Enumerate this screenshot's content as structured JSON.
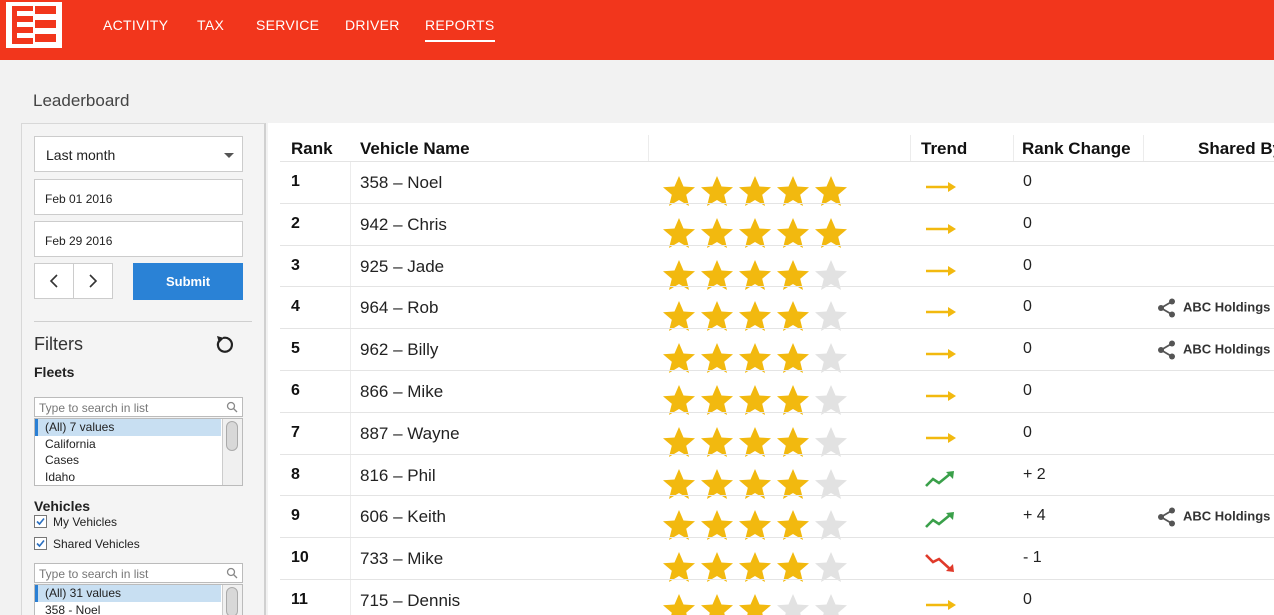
{
  "nav": {
    "items": [
      {
        "label": "ACTIVITY",
        "active": false
      },
      {
        "label": "TAX",
        "active": false
      },
      {
        "label": "SERVICE",
        "active": false
      },
      {
        "label": "DRIVER",
        "active": false
      },
      {
        "label": "REPORTS",
        "active": true
      }
    ]
  },
  "page_title": "Leaderboard",
  "sidebar": {
    "period": "Last month",
    "start_date": "Feb 01 2016",
    "end_date": "Feb 29 2016",
    "submit_label": "Submit",
    "filters_title": "Filters",
    "fleets_label": "Fleets",
    "fleets_search_placeholder": "Type to search in list",
    "fleets": [
      "(All) 7 values",
      "California",
      "Cases",
      "Idaho"
    ],
    "vehicles_label": "Vehicles",
    "my_vehicles_label": "My Vehicles",
    "my_vehicles_checked": true,
    "shared_vehicles_label": "Shared Vehicles",
    "shared_vehicles_checked": true,
    "vehicles_search_placeholder": "Type to search in list",
    "vehicles": [
      "(All) 31 values",
      "358 - Noel"
    ]
  },
  "table": {
    "headers": {
      "rank": "Rank",
      "vehicle": "Vehicle Name",
      "trend": "Trend",
      "rank_change": "Rank Change",
      "shared_by": "Shared By"
    },
    "rows": [
      {
        "rank": "1",
        "name": "358 – Noel",
        "stars": 5,
        "trend": "flat",
        "change": "0",
        "shared_by": ""
      },
      {
        "rank": "2",
        "name": "942 – Chris",
        "stars": 5,
        "trend": "flat",
        "change": "0",
        "shared_by": ""
      },
      {
        "rank": "3",
        "name": "925 – Jade",
        "stars": 4,
        "trend": "flat",
        "change": "0",
        "shared_by": ""
      },
      {
        "rank": "4",
        "name": "964 – Rob",
        "stars": 4,
        "trend": "flat",
        "change": "0",
        "shared_by": "ABC Holdings"
      },
      {
        "rank": "5",
        "name": "962 – Billy",
        "stars": 4,
        "trend": "flat",
        "change": "0",
        "shared_by": "ABC Holdings"
      },
      {
        "rank": "6",
        "name": "866 – Mike",
        "stars": 4,
        "trend": "flat",
        "change": "0",
        "shared_by": ""
      },
      {
        "rank": "7",
        "name": "887 – Wayne",
        "stars": 4,
        "trend": "flat",
        "change": "0",
        "shared_by": ""
      },
      {
        "rank": "8",
        "name": "816 – Phil",
        "stars": 4,
        "trend": "up",
        "change": "+ 2",
        "shared_by": ""
      },
      {
        "rank": "9",
        "name": "606 – Keith",
        "stars": 4,
        "trend": "up",
        "change": "+ 4",
        "shared_by": "ABC Holdings"
      },
      {
        "rank": "10",
        "name": "733 – Mike",
        "stars": 4,
        "trend": "down",
        "change": "- 1",
        "shared_by": ""
      },
      {
        "rank": "11",
        "name": "715 – Dennis",
        "stars": 3,
        "trend": "flat",
        "change": "0",
        "shared_by": ""
      }
    ]
  },
  "colors": {
    "brand": "#f2361c",
    "submit": "#2a82d6",
    "star_on": "#f2b90f",
    "star_off": "#e2e2e2",
    "trend_flat": "#f2b90f",
    "trend_up": "#3aa04a",
    "trend_down": "#e03a2a"
  }
}
